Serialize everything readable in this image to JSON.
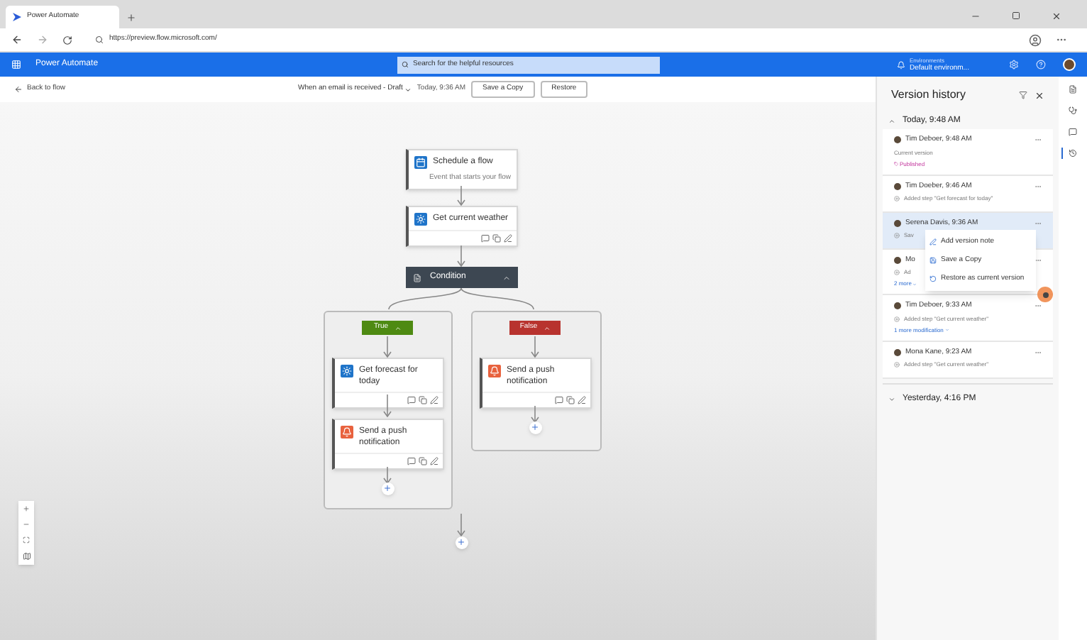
{
  "browser": {
    "tab_title": "Power Automate",
    "url": "https://preview.flow.microsoft.com/"
  },
  "app_bar": {
    "title": "Power Automate",
    "search": {
      "placeholder": "Search for the helpful resources"
    },
    "environment": {
      "label": "Environments",
      "value": "Default environm..."
    }
  },
  "toolbar": {
    "back": "Back to flow",
    "flow_name": "When an email is received - Draft",
    "time": "Today, 9:36 AM",
    "buttons": [
      "Save a Copy",
      "Restore"
    ]
  },
  "flow": {
    "steps": [
      {
        "kind": "trigger",
        "title": "Schedule a flow",
        "subtitle": "Event that starts your flow"
      },
      {
        "kind": "action",
        "title": "Get current weather"
      }
    ],
    "condition": {
      "title": "Condition",
      "expanded": true,
      "branches": [
        {
          "label": "True",
          "color": "#4e8a12",
          "steps": [
            {
              "kind": "weather",
              "title": "Get forecast for today"
            },
            {
              "kind": "notify",
              "title": "Send a push notification"
            }
          ]
        },
        {
          "label": "False",
          "color": "#b8332e",
          "steps": [
            {
              "kind": "notify",
              "title": "Send a push notification"
            }
          ]
        }
      ]
    }
  },
  "version_history": {
    "title": "Version history",
    "groups": [
      {
        "label": "Today, 9:48 AM",
        "expanded": true,
        "entries": [
          {
            "author": "Tim Deboer, 9:48 AM",
            "note": "Current version",
            "tag": "Published",
            "selected": false
          },
          {
            "author": "Tim Doeber, 9:46 AM",
            "note": "Added step \"Get forecast for today\"",
            "selected": false
          },
          {
            "author": "Serena Davis, 9:36 AM",
            "note": "Sav",
            "selected": true
          },
          {
            "author": "Mo",
            "note": "Ad",
            "link": "2 more",
            "selected": false
          },
          {
            "author": "Tim Deboer, 9:33 AM",
            "note": "Added step \"Get current weather\"",
            "link": "1 more modification",
            "selected": false
          },
          {
            "author": "Mona Kane, 9:23 AM",
            "note": "Added step \"Get current weather\"",
            "selected": false
          }
        ]
      },
      {
        "label": "Yesterday, 4:16 PM",
        "expanded": false
      }
    ],
    "menu": [
      "Add version note",
      "Save a Copy",
      "Restore as current version"
    ]
  }
}
